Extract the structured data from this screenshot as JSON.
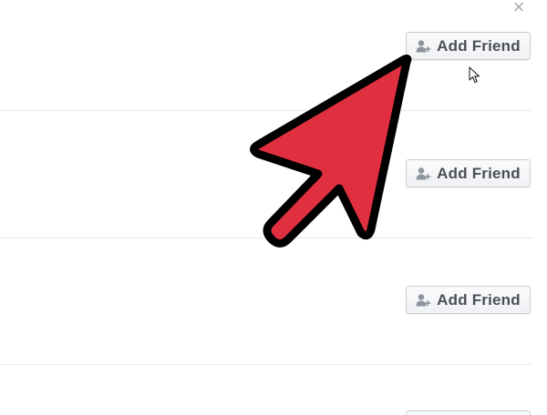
{
  "dialog": {
    "close_symbol": "×",
    "close_icon": "close-icon"
  },
  "rows": [
    {
      "add_friend_label": "Add Friend",
      "icon": "add-friend-icon"
    },
    {
      "add_friend_label": "Add Friend",
      "icon": "add-friend-icon"
    },
    {
      "add_friend_label": "Add Friend",
      "icon": "add-friend-icon"
    }
  ],
  "overlay": {
    "arrow_icon": "red-pointer-arrow-icon",
    "cursor_icon": "mouse-cursor-icon",
    "arrow_color": "#e03040",
    "arrow_outline_color": "#000000"
  },
  "colors": {
    "button_text": "#4b4f56",
    "button_border": "#c9ccd1",
    "divider": "#e6e8ec",
    "close_icon": "#a7aeb9"
  }
}
